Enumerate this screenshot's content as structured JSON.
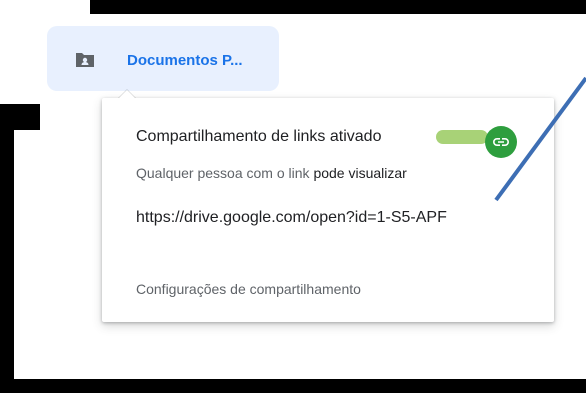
{
  "folder_chip": {
    "label": "Documentos P...",
    "icon": "shared-folder-icon"
  },
  "share_popup": {
    "title": "Compartilhamento de links ativado",
    "toggle_state": "on",
    "toggle_icon": "link-icon",
    "access_prefix": "Qualquer pessoa com o link",
    "access_level": "pode visualizar",
    "url": "https://drive.google.com/open?id=1-S5-APF",
    "settings_label": "Configurações de compartilhamento"
  },
  "colors": {
    "chip_bg": "#e8f0fe",
    "chip_text": "#1a73e8",
    "toggle_on": "#2e9e3e",
    "annotation_arrow": "#3d6eb4"
  }
}
